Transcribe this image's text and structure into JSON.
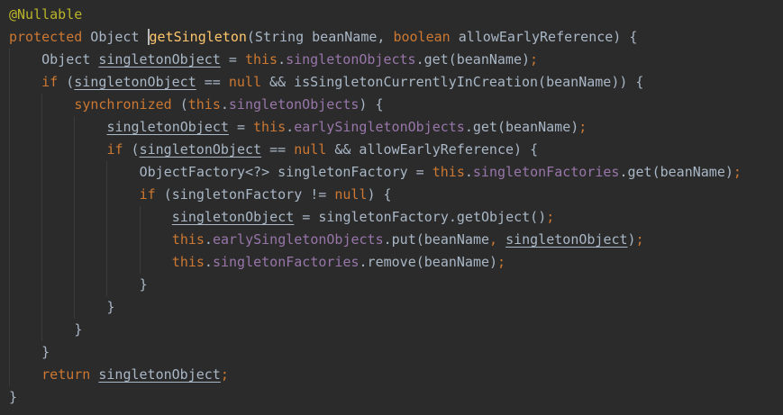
{
  "editor": {
    "theme": {
      "background": "#2b2b2b",
      "text": "#a9b7c6",
      "keyword": "#cc7832",
      "annotation": "#bbb529",
      "field": "#9876aa",
      "method_declaration": "#ffc66d"
    },
    "lines": [
      {
        "indent": 0,
        "tokens": [
          {
            "t": "@Nullable",
            "c": "ann"
          }
        ]
      },
      {
        "indent": 0,
        "tokens": [
          {
            "t": "protected",
            "c": "kw"
          },
          {
            "t": " Object "
          },
          {
            "t": "getSingleton",
            "c": "fn caret-word"
          },
          {
            "t": "(String beanName, "
          },
          {
            "t": "boolean",
            "c": "kw"
          },
          {
            "t": " allowEarlyReference) {"
          }
        ]
      },
      {
        "indent": 1,
        "tokens": [
          {
            "t": "Object "
          },
          {
            "t": "singletonObject",
            "c": "var"
          },
          {
            "t": " = "
          },
          {
            "t": "this",
            "c": "kw"
          },
          {
            "t": "."
          },
          {
            "t": "singletonObjects",
            "c": "fld"
          },
          {
            "t": ".get(beanName)"
          },
          {
            "t": ";",
            "c": "kw"
          }
        ]
      },
      {
        "indent": 1,
        "tokens": [
          {
            "t": "if",
            "c": "kw"
          },
          {
            "t": " ("
          },
          {
            "t": "singletonObject",
            "c": "var"
          },
          {
            "t": " == "
          },
          {
            "t": "null",
            "c": "kw"
          },
          {
            "t": " && isSingletonCurrentlyInCreation(beanName)) {"
          }
        ]
      },
      {
        "indent": 2,
        "tokens": [
          {
            "t": "synchronized",
            "c": "kw"
          },
          {
            "t": " ("
          },
          {
            "t": "this",
            "c": "kw"
          },
          {
            "t": "."
          },
          {
            "t": "singletonObjects",
            "c": "fld"
          },
          {
            "t": ") {"
          }
        ]
      },
      {
        "indent": 3,
        "tokens": [
          {
            "t": "singletonObject",
            "c": "var"
          },
          {
            "t": " = "
          },
          {
            "t": "this",
            "c": "kw"
          },
          {
            "t": "."
          },
          {
            "t": "earlySingletonObjects",
            "c": "fld"
          },
          {
            "t": ".get(beanName)"
          },
          {
            "t": ";",
            "c": "kw"
          }
        ]
      },
      {
        "indent": 3,
        "tokens": [
          {
            "t": "if",
            "c": "kw"
          },
          {
            "t": " ("
          },
          {
            "t": "singletonObject",
            "c": "var"
          },
          {
            "t": " == "
          },
          {
            "t": "null",
            "c": "kw"
          },
          {
            "t": " && allowEarlyReference) {"
          }
        ]
      },
      {
        "indent": 4,
        "tokens": [
          {
            "t": "ObjectFactory<?> singletonFactory = "
          },
          {
            "t": "this",
            "c": "kw"
          },
          {
            "t": "."
          },
          {
            "t": "singletonFactories",
            "c": "fld"
          },
          {
            "t": ".get(beanName)"
          },
          {
            "t": ";",
            "c": "kw"
          }
        ]
      },
      {
        "indent": 4,
        "tokens": [
          {
            "t": "if",
            "c": "kw"
          },
          {
            "t": " (singletonFactory != "
          },
          {
            "t": "null",
            "c": "kw"
          },
          {
            "t": ") {"
          }
        ]
      },
      {
        "indent": 5,
        "tokens": [
          {
            "t": "singletonObject",
            "c": "var"
          },
          {
            "t": " = singletonFactory.getObject()"
          },
          {
            "t": ";",
            "c": "kw"
          }
        ]
      },
      {
        "indent": 5,
        "tokens": [
          {
            "t": "this",
            "c": "kw"
          },
          {
            "t": "."
          },
          {
            "t": "earlySingletonObjects",
            "c": "fld"
          },
          {
            "t": ".put(beanName"
          },
          {
            "t": ",",
            "c": "kw"
          },
          {
            "t": " "
          },
          {
            "t": "singletonObject",
            "c": "var"
          },
          {
            "t": ")"
          },
          {
            "t": ";",
            "c": "kw"
          }
        ]
      },
      {
        "indent": 5,
        "tokens": [
          {
            "t": "this",
            "c": "kw"
          },
          {
            "t": "."
          },
          {
            "t": "singletonFactories",
            "c": "fld"
          },
          {
            "t": ".remove(beanName)"
          },
          {
            "t": ";",
            "c": "kw"
          }
        ]
      },
      {
        "indent": 4,
        "tokens": [
          {
            "t": "}"
          }
        ]
      },
      {
        "indent": 3,
        "tokens": [
          {
            "t": "}"
          }
        ]
      },
      {
        "indent": 2,
        "tokens": [
          {
            "t": "}"
          }
        ]
      },
      {
        "indent": 1,
        "tokens": [
          {
            "t": "}"
          }
        ]
      },
      {
        "indent": 1,
        "tokens": [
          {
            "t": "return",
            "c": "kw"
          },
          {
            "t": " "
          },
          {
            "t": "singletonObject",
            "c": "var"
          },
          {
            "t": ";",
            "c": "kw"
          }
        ]
      },
      {
        "indent": 0,
        "tokens": [
          {
            "t": "}"
          }
        ]
      }
    ]
  }
}
